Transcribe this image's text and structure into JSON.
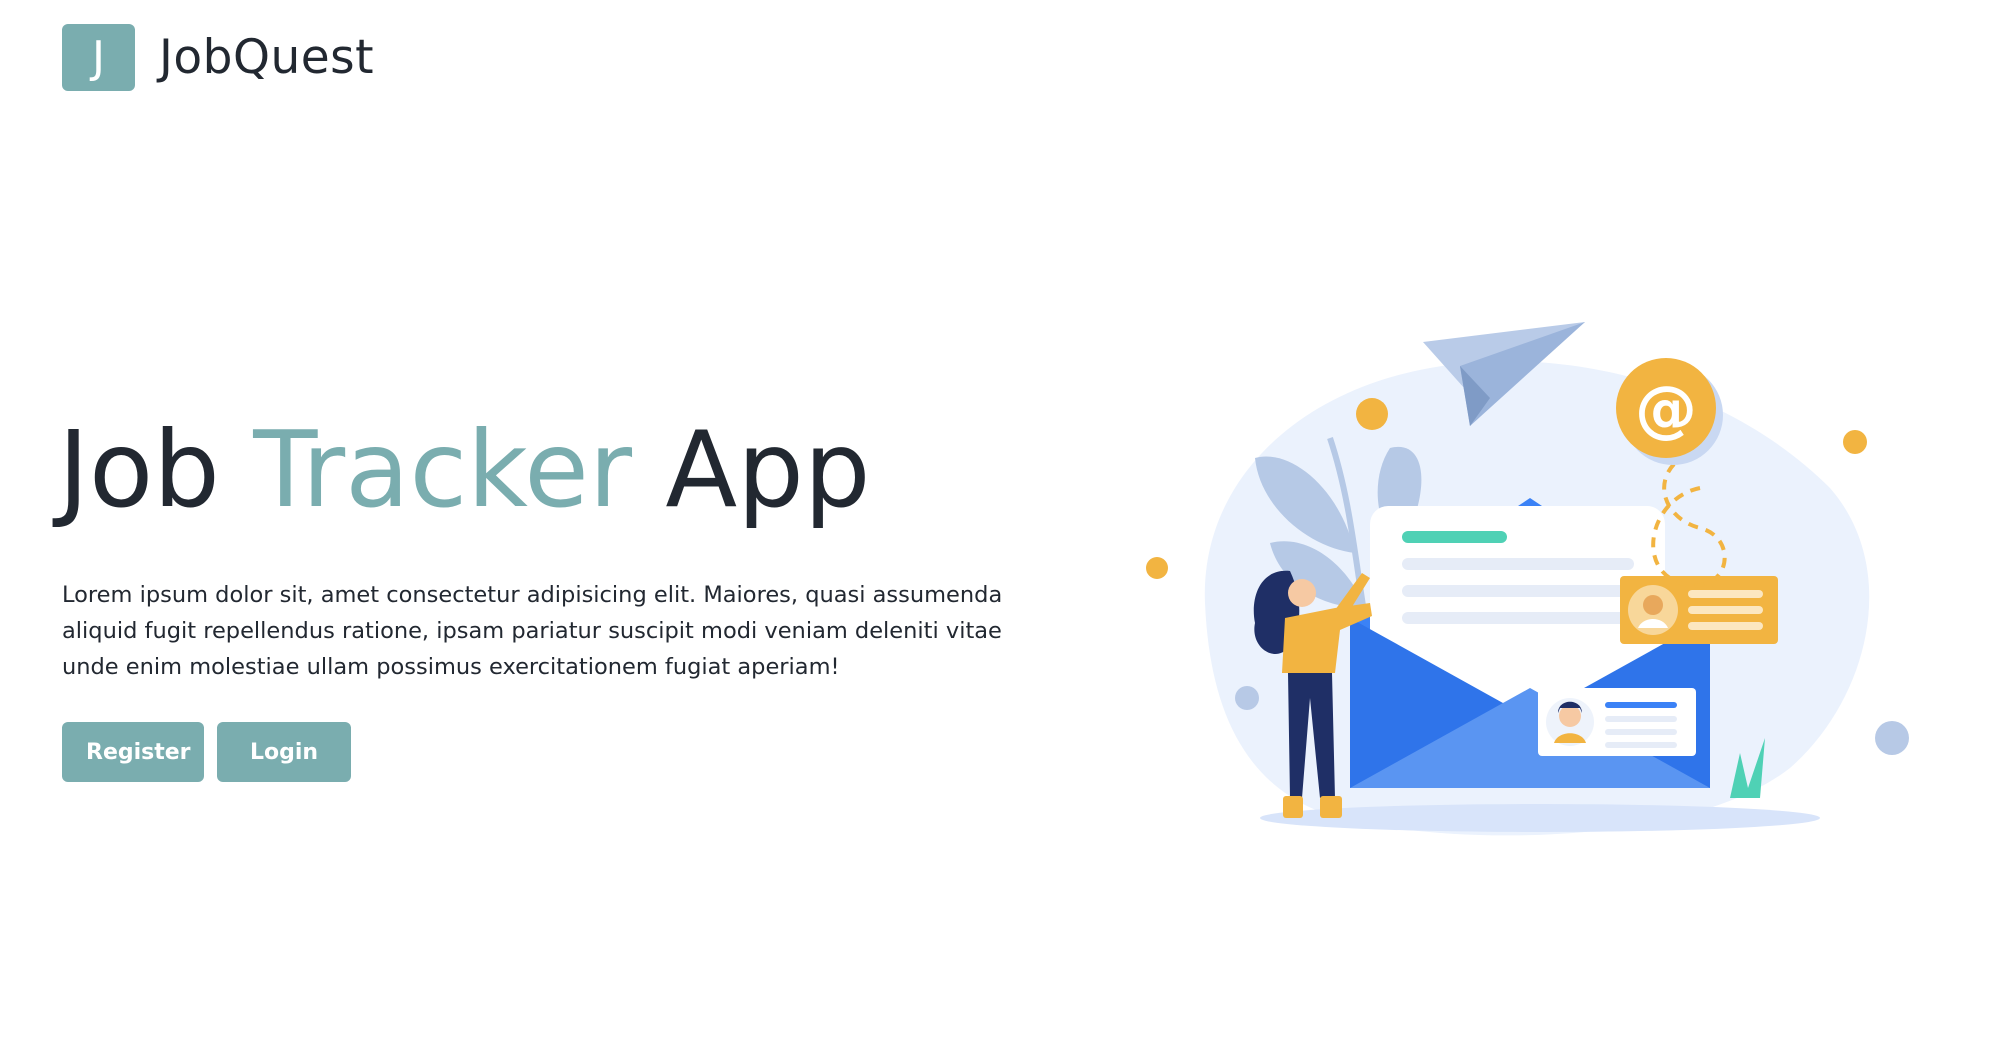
{
  "brand": {
    "logo_letter": "J",
    "name": "JobQuest"
  },
  "hero": {
    "title_part1": "Job ",
    "title_accent": "Tracker",
    "title_part2": " App",
    "description": "Lorem ipsum dolor sit, amet consectetur adipisicing elit. Maiores, quasi assumenda aliquid fugit repellendus ratione, ipsam pariatur suscipit modi veniam deleniti vitae unde enim molestiae ullam possimus exercitationem fugiat aperiam!"
  },
  "actions": {
    "register_label": "Register",
    "login_label": "Login"
  },
  "colors": {
    "accent": "#7aadaf",
    "text": "#222831",
    "envelope_blue": "#3b82f6",
    "orange": "#f2b441"
  },
  "illustration": {
    "name": "job-application-mail-illustration",
    "at_symbol": "@"
  }
}
